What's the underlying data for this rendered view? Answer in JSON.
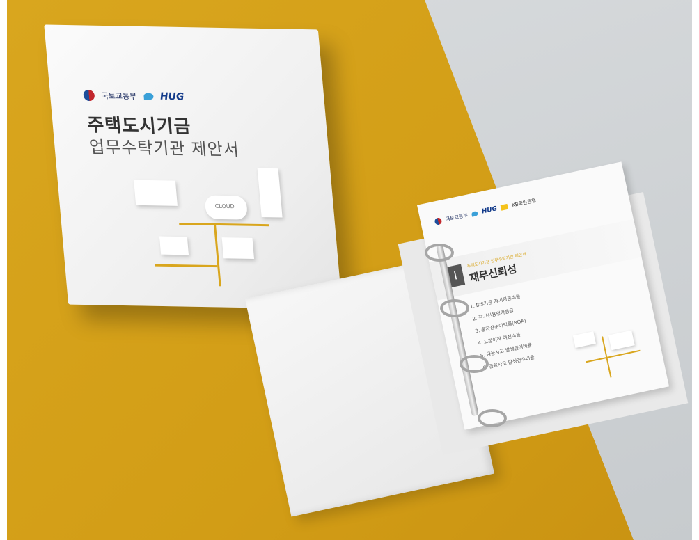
{
  "cover": {
    "org_label": "국토교통부",
    "brand_label": "HUG",
    "title_line1": "주택도시기금",
    "title_line2": "업무수탁기관 제안서",
    "art_cloud_label": "CLOUD"
  },
  "page": {
    "org_label": "국토교통부",
    "brand_label": "HUG",
    "partner_label": "KB국민은행",
    "chapter_number": "I",
    "chapter_small": "주택도시기금 업무수탁기관 제안서",
    "chapter_title": "재무신뢰성",
    "toc": [
      "1. BIS기준 자기자본비율",
      "2. 장기신용평가등급",
      "3. 총자산순이익률(ROA)",
      "4. 고정이하 여신비율",
      "5. 금융사고 발생금액비율",
      "6. 금융사고 발생건수비율"
    ]
  },
  "colors": {
    "background_gold": "#d9a61e",
    "background_grey": "#d2d5d8",
    "binder_white": "#f4f4f4",
    "accent_gold": "#d9a61e"
  }
}
